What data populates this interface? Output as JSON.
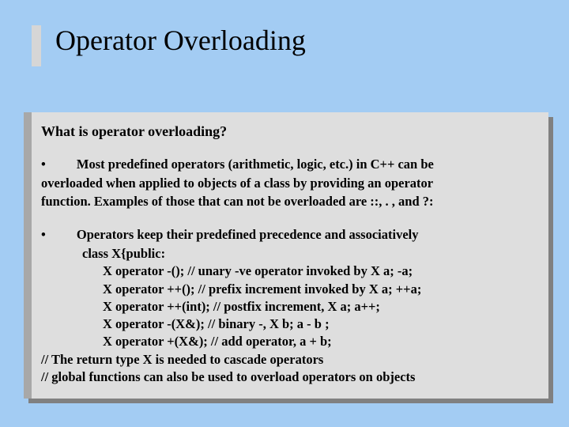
{
  "title": "Operator Overloading",
  "heading": "What is operator overloading?",
  "bullet1_line1": "Most predefined operators (arithmetic, logic, etc.) in C++ can be",
  "bullet1_line2": "overloaded when applied to objects of  a class by providing an operator",
  "bullet1_line3": "function. Examples of those that can not  be overloaded are ::, . ,  and ?:",
  "bullet2_line1": "Operators keep their predefined precedence and associatively",
  "class_decl": "class X{public:",
  "code1": "X operator -(); // unary -ve operator invoked by X a; -a;",
  "code2": "X operator ++(); // prefix increment invoked by X a; ++a;",
  "code3": "X operator ++(int); // postfix increment, X a; a++;",
  "code4": "X operator -(X&); // binary -, X b; a - b ;",
  "code5": "X operator +(X&); // add operator,  a + b;",
  "comment1": "// The return type X is needed to cascade operators",
  "comment2": "// global functions can also be used to overload operators on objects"
}
